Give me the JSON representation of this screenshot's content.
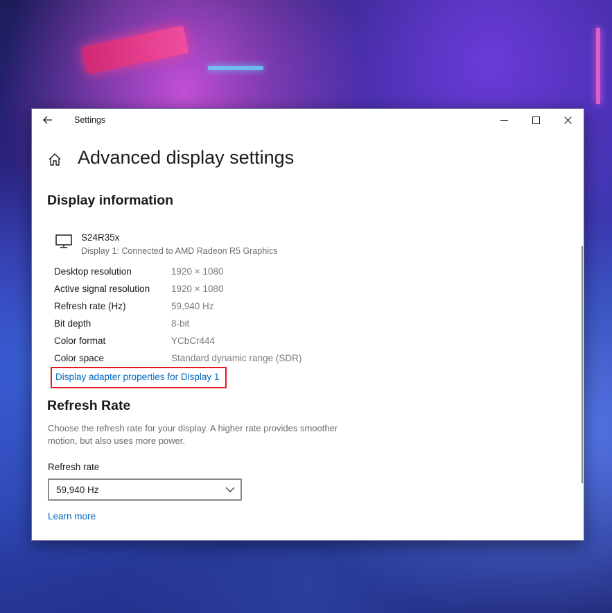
{
  "window": {
    "title": "Settings"
  },
  "page": {
    "title": "Advanced display settings"
  },
  "display_info": {
    "heading": "Display information",
    "monitor_name": "S24R35x",
    "monitor_sub": "Display 1: Connected to AMD Radeon R5 Graphics",
    "rows": [
      {
        "label": "Desktop resolution",
        "value": "1920 × 1080"
      },
      {
        "label": "Active signal resolution",
        "value": "1920 × 1080"
      },
      {
        "label": "Refresh rate (Hz)",
        "value": "59,940 Hz"
      },
      {
        "label": "Bit depth",
        "value": "8-bit"
      },
      {
        "label": "Color format",
        "value": "YCbCr444"
      },
      {
        "label": "Color space",
        "value": "Standard dynamic range (SDR)"
      }
    ],
    "adapter_link": "Display adapter properties for Display 1"
  },
  "refresh": {
    "heading": "Refresh Rate",
    "description": "Choose the refresh rate for your display. A higher rate provides smoother motion, but also uses more power.",
    "field_label": "Refresh rate",
    "selected": "59,940 Hz",
    "learn_more": "Learn more"
  },
  "colors": {
    "link": "#0067c0",
    "highlight": "#e0191f"
  },
  "icons": {
    "back": "arrow-left-icon",
    "home": "home-icon",
    "monitor": "monitor-icon",
    "minimize": "minimize-icon",
    "maximize": "maximize-icon",
    "close": "close-icon",
    "dropdown": "chevron-down-icon"
  }
}
